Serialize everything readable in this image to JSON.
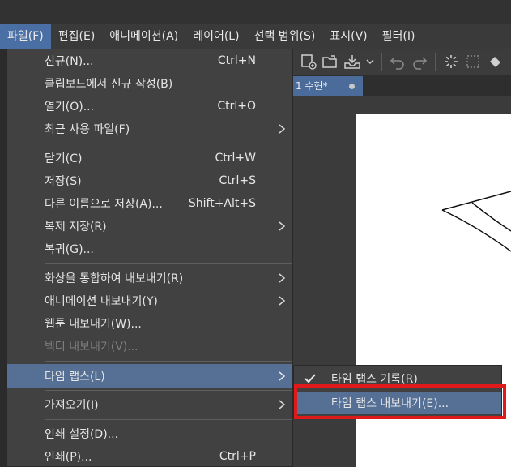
{
  "menubar": {
    "items": [
      {
        "label": "파일(F)",
        "active": true
      },
      {
        "label": "편집(E)"
      },
      {
        "label": "애니메이션(A)"
      },
      {
        "label": "레이어(L)"
      },
      {
        "label": "선택 범위(S)"
      },
      {
        "label": "표시(V)"
      },
      {
        "label": "필터(I)"
      }
    ]
  },
  "toolbar": {
    "icons": [
      "new-canvas-icon",
      "open-folder-icon",
      "save-icon",
      "chevron-down-icon",
      "undo-icon",
      "redo-icon",
      "loading-spinner-icon",
      "selection-icon",
      "fill-icon"
    ]
  },
  "document_tab": {
    "label": "1 수현*"
  },
  "file_menu": {
    "items": [
      {
        "label": "신규(N)...",
        "shortcut": "Ctrl+N"
      },
      {
        "label": "클립보드에서 신규 작성(B)",
        "shortcut": ""
      },
      {
        "label": "열기(O)...",
        "shortcut": "Ctrl+O"
      },
      {
        "label": "최근 사용 파일(F)",
        "shortcut": "",
        "submenu": true
      },
      {
        "label": "닫기(C)",
        "shortcut": "Ctrl+W"
      },
      {
        "label": "저장(S)",
        "shortcut": "Ctrl+S"
      },
      {
        "label": "다른 이름으로 저장(A)...",
        "shortcut": "Shift+Alt+S"
      },
      {
        "label": "복제 저장(R)",
        "shortcut": "",
        "submenu": true
      },
      {
        "label": "복귀(G)...",
        "shortcut": ""
      },
      {
        "label": "화상을 통합하여 내보내기(R)",
        "shortcut": "",
        "submenu": true
      },
      {
        "label": "애니메이션 내보내기(Y)",
        "shortcut": "",
        "submenu": true
      },
      {
        "label": "웹툰 내보내기(W)...",
        "shortcut": ""
      },
      {
        "label": "벡터 내보내기(V)...",
        "shortcut": "",
        "disabled": true
      },
      {
        "label": "타임 랩스(L)",
        "shortcut": "",
        "submenu": true,
        "highlighted": true
      },
      {
        "label": "가져오기(I)",
        "shortcut": "",
        "submenu": true
      },
      {
        "label": "인쇄 설정(D)...",
        "shortcut": ""
      },
      {
        "label": "인쇄(P)...",
        "shortcut": "Ctrl+P"
      }
    ]
  },
  "timelapse_submenu": {
    "items": [
      {
        "label": "타임 랩스 기록(R)",
        "checked": true
      },
      {
        "label": "타임 랩스 내보내기(E)...",
        "highlighted": true
      }
    ]
  },
  "colors": {
    "highlight": "#566f95",
    "annotation_box": "#e01a1a",
    "menu_bg": "#414141"
  }
}
